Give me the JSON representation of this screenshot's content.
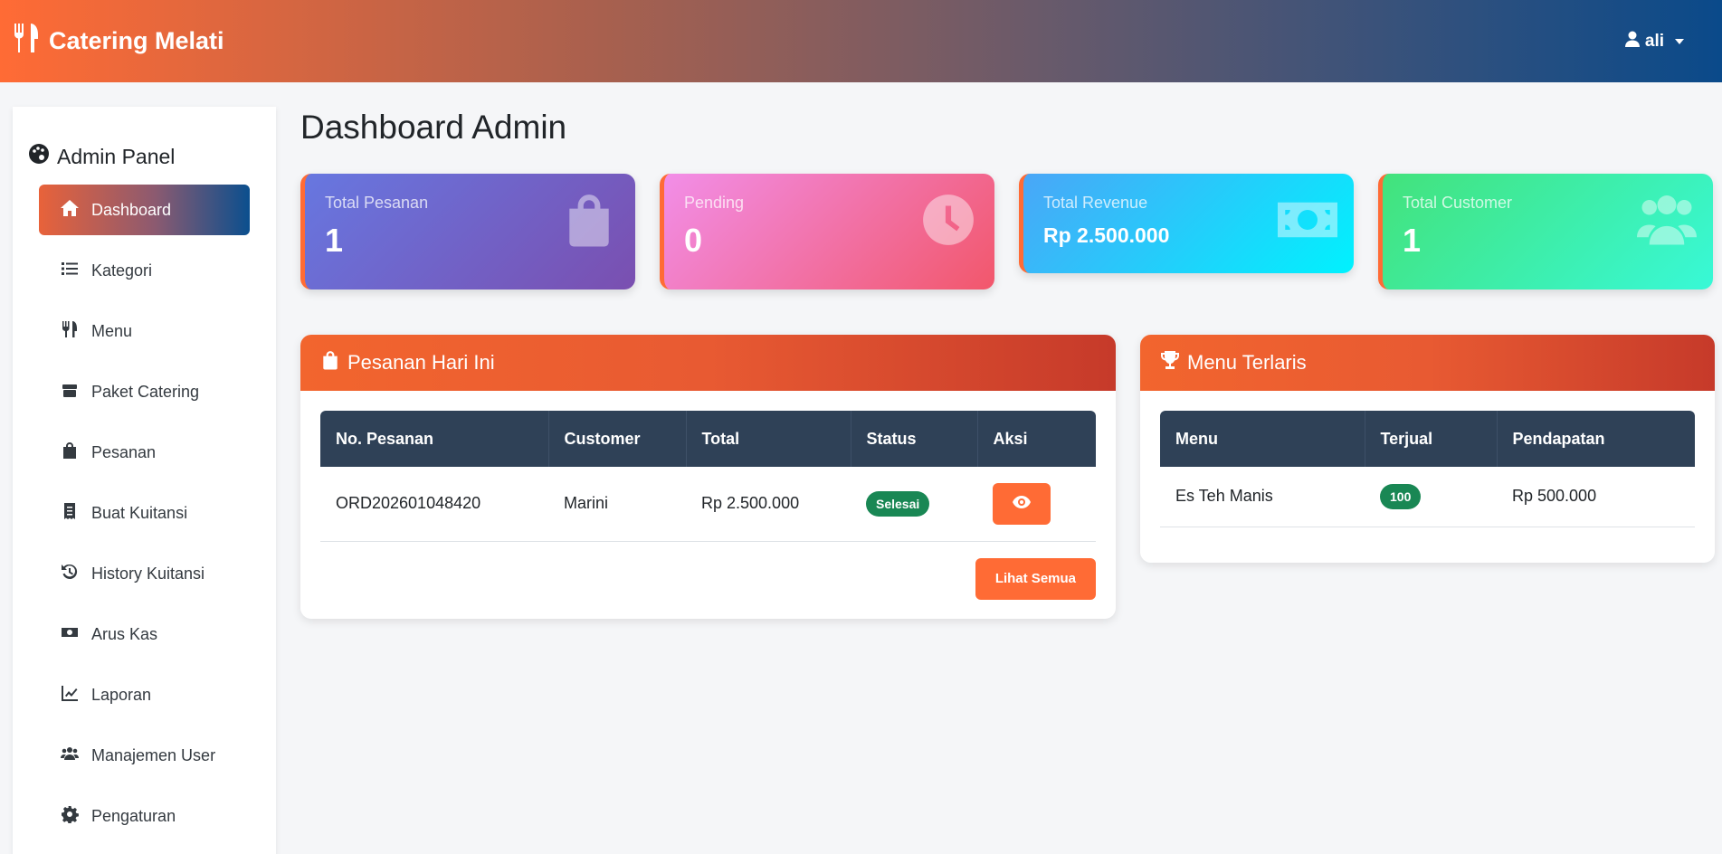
{
  "app": {
    "brand": "Catering Melati",
    "user": "ali"
  },
  "sidebar": {
    "title": "Admin Panel",
    "items": [
      {
        "label": "Dashboard",
        "icon": "home-icon",
        "active": true
      },
      {
        "label": "Kategori",
        "icon": "list-icon"
      },
      {
        "label": "Menu",
        "icon": "utensils-icon"
      },
      {
        "label": "Paket Catering",
        "icon": "box-icon"
      },
      {
        "label": "Pesanan",
        "icon": "shopping-bag-icon"
      },
      {
        "label": "Buat Kuitansi",
        "icon": "receipt-icon"
      },
      {
        "label": "History Kuitansi",
        "icon": "history-icon"
      },
      {
        "label": "Arus Kas",
        "icon": "money-icon"
      },
      {
        "label": "Laporan",
        "icon": "chart-line-icon"
      },
      {
        "label": "Manajemen User",
        "icon": "users-icon"
      },
      {
        "label": "Pengaturan",
        "icon": "gear-icon"
      }
    ]
  },
  "page": {
    "title": "Dashboard Admin"
  },
  "stats": [
    {
      "label": "Total Pesanan",
      "value": "1",
      "icon": "shopping-bag-icon"
    },
    {
      "label": "Pending",
      "value": "0",
      "icon": "clock-icon"
    },
    {
      "label": "Total Revenue",
      "value": "Rp 2.500.000",
      "icon": "money-icon"
    },
    {
      "label": "Total Customer",
      "value": "1",
      "icon": "users-icon"
    }
  ],
  "orders_panel": {
    "title": "Pesanan Hari Ini",
    "columns": [
      "No. Pesanan",
      "Customer",
      "Total",
      "Status",
      "Aksi"
    ],
    "rows": [
      {
        "order_no": "ORD202601048420",
        "customer": "Marini",
        "total": "Rp 2.500.000",
        "status": "Selesai"
      }
    ],
    "view_all": "Lihat Semua"
  },
  "top_menu_panel": {
    "title": "Menu Terlaris",
    "columns": [
      "Menu",
      "Terjual",
      "Pendapatan"
    ],
    "rows": [
      {
        "menu": "Es Teh Manis",
        "sold": "100",
        "revenue": "Rp 500.000"
      }
    ]
  },
  "colors": {
    "accent": "#ff6b35",
    "header_dark": "#2f4157",
    "success": "#198754"
  }
}
